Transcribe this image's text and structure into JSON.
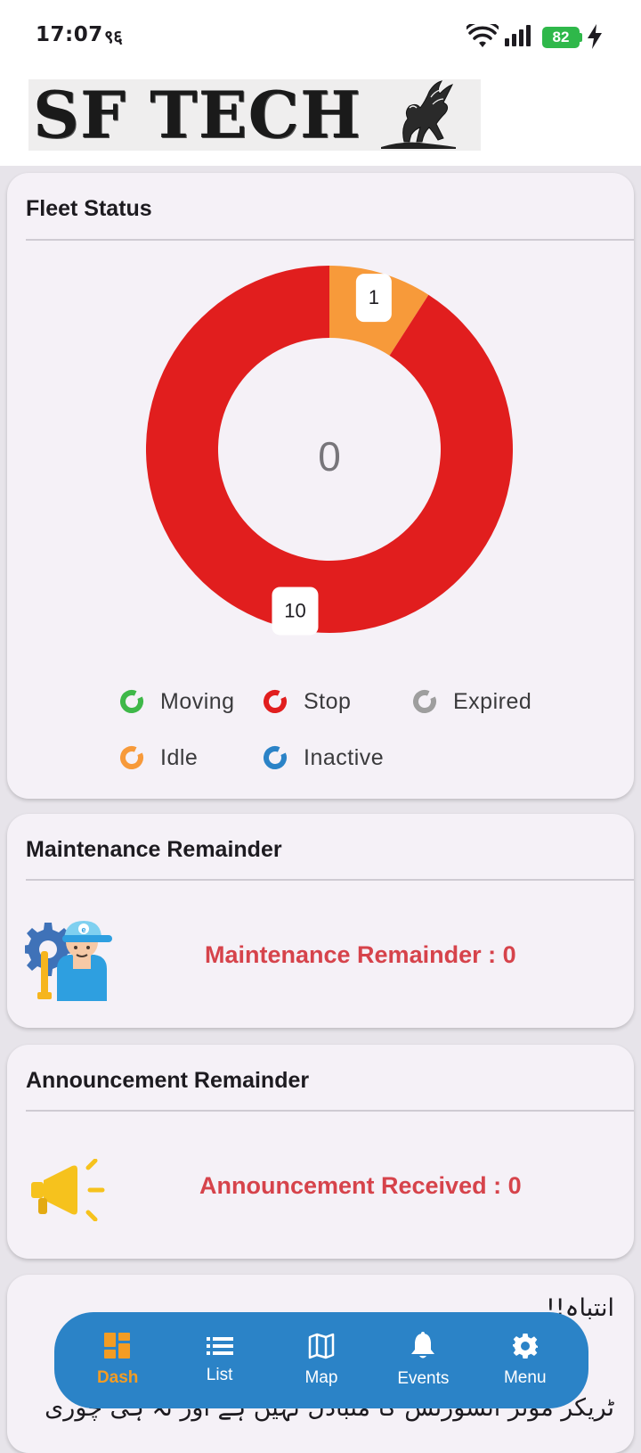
{
  "status_bar": {
    "time": "17:07",
    "notification_glyph": "९६",
    "battery_level": "82",
    "icons": [
      "wifi-icon",
      "signal-icon",
      "battery-icon",
      "charging-icon"
    ]
  },
  "logo": {
    "text": "SF TECH"
  },
  "fleet_status": {
    "title": "Fleet Status",
    "center_value": "0",
    "segments": [
      {
        "name": "Idle",
        "value": 1,
        "color": "#f79a3a",
        "label": "1"
      },
      {
        "name": "Stop",
        "value": 10,
        "color": "#e11e1e",
        "label": "10"
      }
    ],
    "legend": [
      {
        "label": "Moving",
        "color": "#3fb849"
      },
      {
        "label": "Stop",
        "color": "#e11e1e"
      },
      {
        "label": "Expired",
        "color": "#9e9e9e"
      },
      {
        "label": "Idle",
        "color": "#f79a3a"
      },
      {
        "label": "Inactive",
        "color": "#2b83c7"
      }
    ]
  },
  "maintenance": {
    "title": "Maintenance Remainder",
    "text": "Maintenance Remainder : 0",
    "icon": "mechanic-icon"
  },
  "announcement": {
    "title": "Announcement Remainder",
    "text": "Announcement Received : 0",
    "icon": "megaphone-icon"
  },
  "notice": {
    "heading": "انتباہ!!",
    "body": "ٹریکر موٹر انشورنس کا متبادل نہیں ہے اور نہ ہی چوری"
  },
  "nav": {
    "items": [
      {
        "label": "Dash",
        "icon": "dashboard-icon",
        "active": true
      },
      {
        "label": "List",
        "icon": "list-icon",
        "active": false
      },
      {
        "label": "Map",
        "icon": "map-icon",
        "active": false
      },
      {
        "label": "Events",
        "icon": "bell-icon",
        "active": false
      },
      {
        "label": "Menu",
        "icon": "gear-icon",
        "active": false
      }
    ]
  },
  "colors": {
    "accent": "#2b83c7",
    "active_nav": "#f39c23",
    "reminder_text": "#d6434b"
  }
}
